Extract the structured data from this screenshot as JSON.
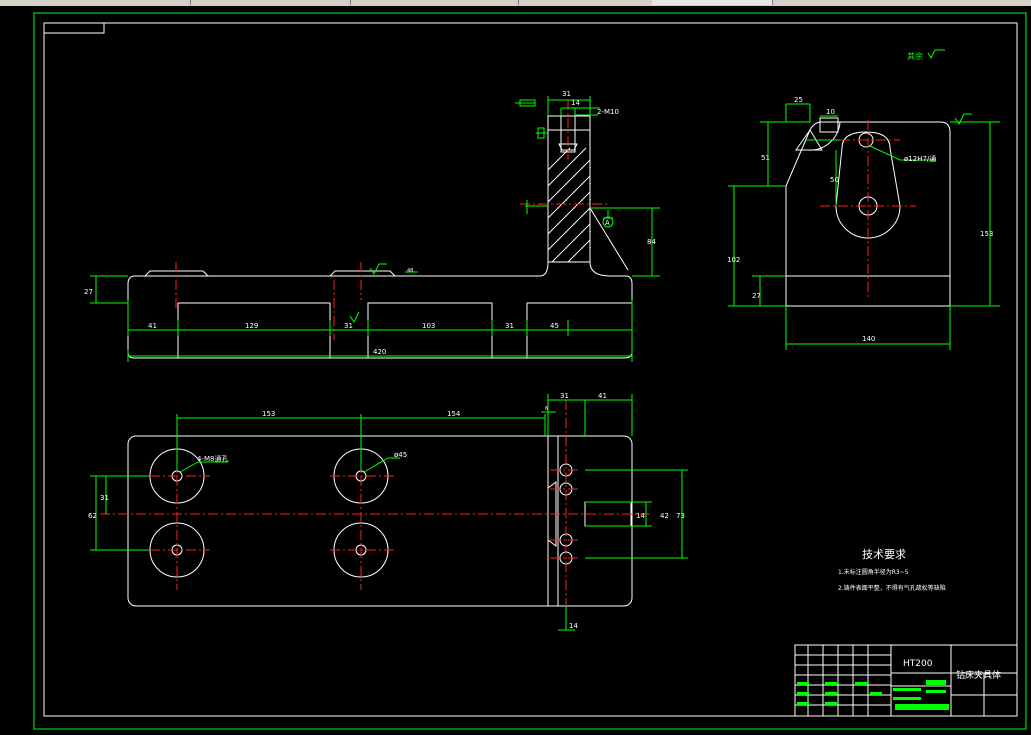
{
  "colors": {
    "background": "#000000",
    "outline": "#ffffff",
    "dimension": "#00ff00",
    "centerline": "#ff2020",
    "titleblock_bar": "#00ff00"
  },
  "roughness_note": "其余",
  "front_view": {
    "dims": {
      "d27": "27",
      "d41": "41",
      "d129": "129",
      "d31a": "31",
      "d103": "103",
      "d31b": "31",
      "d45": "45",
      "d420": "420",
      "d84": "84",
      "d31top": "31",
      "d14top": "14",
      "thread": "2-M10",
      "datum": "A",
      "d48": "48"
    }
  },
  "side_view": {
    "dims": {
      "d25": "25",
      "d10": "10",
      "d51": "51",
      "d50": "50",
      "d102": "102",
      "d27": "27",
      "d153": "153",
      "d140": "140",
      "hole": "ø12H7/通"
    }
  },
  "top_view": {
    "dims": {
      "d153": "153",
      "d154": "154",
      "d31": "31",
      "d41": "41",
      "d6": "6",
      "d62": "62",
      "d31v": "31",
      "d14": "14",
      "d42": "42",
      "d73": "73",
      "d14b": "14",
      "d45": "ø45",
      "thru": "4-M8通孔"
    }
  },
  "tech_req": {
    "title": "技术要求",
    "items": [
      "1.未标注圆角半径为R3~5",
      "2.铸件表面平整，不得有气孔疏松等缺陷"
    ]
  },
  "title_block": {
    "material": "HT200",
    "name": "钻床夹具体"
  }
}
